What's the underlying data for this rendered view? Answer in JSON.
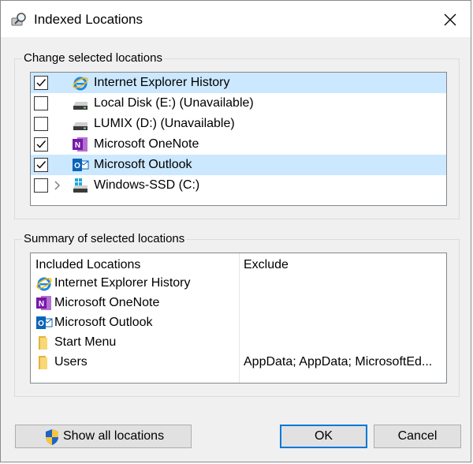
{
  "window": {
    "title": "Indexed Locations"
  },
  "change_group": {
    "label": "Change selected locations",
    "items": [
      {
        "label": "Internet Explorer History",
        "checked": true,
        "selected": true,
        "expandable": false,
        "icon": "internet-explorer-icon"
      },
      {
        "label": "Local Disk (E:) (Unavailable)",
        "checked": false,
        "selected": false,
        "expandable": false,
        "icon": "drive-icon"
      },
      {
        "label": "LUMIX (D:) (Unavailable)",
        "checked": false,
        "selected": false,
        "expandable": false,
        "icon": "drive-icon"
      },
      {
        "label": "Microsoft OneNote",
        "checked": true,
        "selected": false,
        "expandable": false,
        "icon": "onenote-icon"
      },
      {
        "label": "Microsoft Outlook",
        "checked": true,
        "selected": true,
        "expandable": false,
        "icon": "outlook-icon"
      },
      {
        "label": "Windows-SSD (C:)",
        "checked": false,
        "selected": false,
        "expandable": true,
        "icon": "system-drive-icon"
      }
    ]
  },
  "summary_group": {
    "label": "Summary of selected locations",
    "col_included": "Included Locations",
    "col_exclude": "Exclude",
    "rows": [
      {
        "label": "Internet Explorer History",
        "exclude": "",
        "icon": "internet-explorer-icon"
      },
      {
        "label": "Microsoft OneNote",
        "exclude": "",
        "icon": "onenote-icon"
      },
      {
        "label": "Microsoft Outlook",
        "exclude": "",
        "icon": "outlook-icon"
      },
      {
        "label": "Start Menu",
        "exclude": "",
        "icon": "folder-icon"
      },
      {
        "label": "Users",
        "exclude": "AppData; AppData; MicrosoftEd...",
        "icon": "folder-icon"
      }
    ]
  },
  "buttons": {
    "show_all": "Show all locations",
    "ok": "OK",
    "cancel": "Cancel"
  },
  "colors": {
    "selection": "#cce8ff",
    "accent": "#0078d7"
  }
}
